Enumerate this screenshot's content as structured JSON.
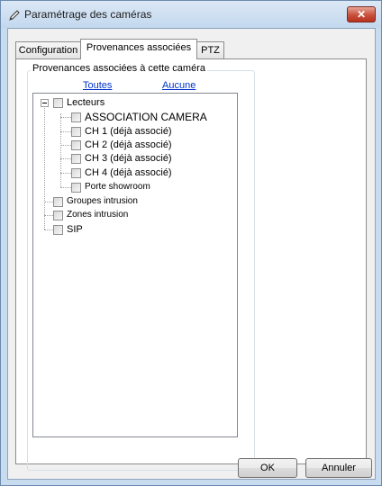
{
  "window": {
    "title": "Paramétrage des caméras",
    "close_label": "✕"
  },
  "tabs": [
    {
      "label": "Configuration",
      "active": false
    },
    {
      "label": "Provenances associées",
      "active": true
    },
    {
      "label": "PTZ",
      "active": false
    }
  ],
  "group": {
    "title": "Provenances associées à cette caméra",
    "select_all": "Toutes",
    "select_none": "Aucune"
  },
  "tree": {
    "lecteurs": {
      "label": "Lecteurs",
      "children": [
        "ASSOCIATION CAMERA",
        "CH 1 (déjà associé)",
        "CH 2 (déjà associé)",
        "CH 3 (déjà associé)",
        "CH 4 (déjà associé)",
        "Porte showroom"
      ]
    },
    "others": [
      "Groupes intrusion",
      "Zones intrusion",
      "SIP"
    ]
  },
  "buttons": {
    "ok": "OK",
    "cancel": "Annuler"
  }
}
